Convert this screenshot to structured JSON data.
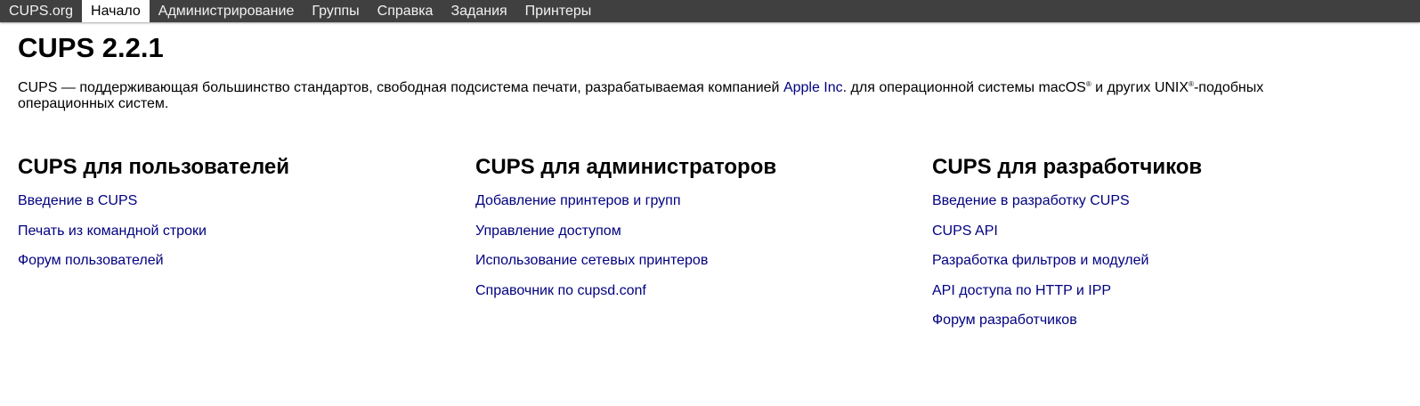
{
  "nav": {
    "items": [
      {
        "label": "CUPS.org",
        "active": false
      },
      {
        "label": "Начало",
        "active": true
      },
      {
        "label": "Администрирование",
        "active": false
      },
      {
        "label": "Группы",
        "active": false
      },
      {
        "label": "Справка",
        "active": false
      },
      {
        "label": "Задания",
        "active": false
      },
      {
        "label": "Принтеры",
        "active": false
      }
    ]
  },
  "page": {
    "title": "CUPS 2.2.1",
    "intro_before_link": "CUPS — поддерживающая большинство стандартов, свободная подсистема печати, разрабатываемая компанией ",
    "intro_link": "Apple Inc",
    "intro_mid": ". для операционной системы macOS",
    "intro_reg1": "®",
    "intro_mid2": " и других UNIX",
    "intro_reg2": "®",
    "intro_after": "-подобных операционных систем."
  },
  "sections": {
    "users": {
      "heading": "CUPS для пользователей",
      "links": [
        "Введение в CUPS",
        "Печать из командной строки",
        "Форум пользователей"
      ]
    },
    "admins": {
      "heading": "CUPS для администраторов",
      "links": [
        "Добавление принтеров и групп",
        "Управление доступом",
        "Использование сетевых принтеров",
        "Справочник по cupsd.conf"
      ]
    },
    "developers": {
      "heading": "CUPS для разработчиков",
      "links": [
        "Введение в разработку CUPS",
        "CUPS API",
        "Разработка фильтров и модулей",
        "API доступа по HTTP и IPP",
        "Форум разработчиков"
      ]
    }
  },
  "colors": {
    "topbar_bg": "#404040",
    "topbar_text": "#f2f2f2",
    "link": "#000080"
  }
}
